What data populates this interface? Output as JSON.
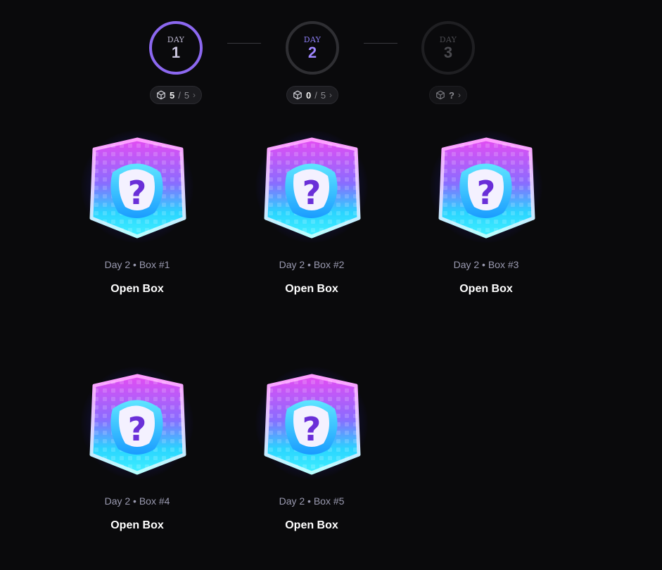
{
  "days": [
    {
      "label": "DAY",
      "number": "1",
      "state": "completed",
      "count": "5",
      "separator": "/",
      "total": "5"
    },
    {
      "label": "DAY",
      "number": "2",
      "state": "active",
      "count": "0",
      "separator": "/",
      "total": "5"
    },
    {
      "label": "DAY",
      "number": "3",
      "state": "locked",
      "count": "?",
      "separator": "",
      "total": ""
    }
  ],
  "pill_icons": {
    "cube": "cube-icon",
    "chevron": "chevron-right-icon"
  },
  "boxes": [
    {
      "caption": "Day 2 • Box #1",
      "button_label": "Open Box"
    },
    {
      "caption": "Day 2 • Box #2",
      "button_label": "Open Box"
    },
    {
      "caption": "Day 2 • Box #3",
      "button_label": "Open Box"
    },
    {
      "caption": "Day 2 • Box #4",
      "button_label": "Open Box"
    },
    {
      "caption": "Day 2 • Box #5",
      "button_label": "Open Box"
    }
  ],
  "colors": {
    "background": "#0a0a0c",
    "accent_purple": "#8c68f0",
    "box_cyan": "#2ee6ff",
    "box_magenta": "#e040fb"
  }
}
